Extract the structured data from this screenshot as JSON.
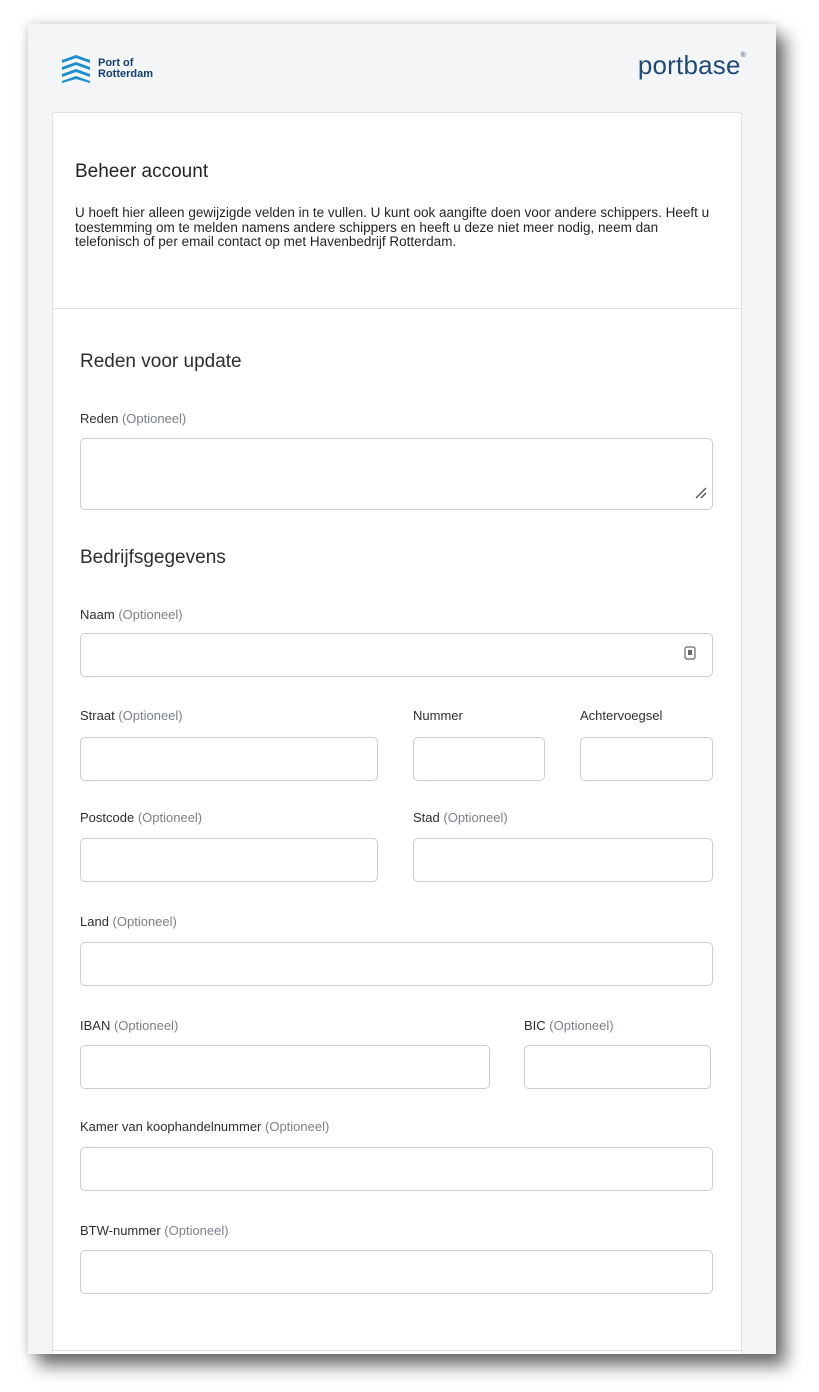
{
  "header": {
    "por_logo_line1": "Port of",
    "por_logo_line2": "Rotterdam",
    "portbase_logo": "portbase",
    "portbase_reg": "®"
  },
  "intro": {
    "title": "Beheer account",
    "text": "U hoeft hier alleen gewijzigde velden in te vullen. U kunt ook aangifte doen voor andere schippers. Heeft u toestemming om te melden namens andere schippers en heeft u deze niet meer nodig, neem dan telefonisch of per email contact op met Havenbedrijf Rotterdam."
  },
  "sections": {
    "reason_title": "Reden voor update",
    "company_title": "Bedrijfsgegevens"
  },
  "optional_suffix": "(Optioneel)",
  "fields": {
    "reden": {
      "label": "Reden",
      "value": ""
    },
    "naam": {
      "label": "Naam",
      "value": ""
    },
    "straat": {
      "label": "Straat",
      "value": ""
    },
    "nummer": {
      "label": "Nummer",
      "value": ""
    },
    "achtervoegsel": {
      "label": "Achtervoegsel",
      "value": ""
    },
    "postcode": {
      "label": "Postcode",
      "value": ""
    },
    "stad": {
      "label": "Stad",
      "value": ""
    },
    "land": {
      "label": "Land",
      "value": ""
    },
    "iban": {
      "label": "IBAN",
      "value": ""
    },
    "bic": {
      "label": "BIC",
      "value": ""
    },
    "kvk": {
      "label": "Kamer van koophandelnummer",
      "value": ""
    },
    "btw": {
      "label": "BTW-nummer",
      "value": ""
    }
  },
  "icons": {
    "resize": "resize-handle-icon",
    "password_manager": "password-manager-icon"
  },
  "colors": {
    "brand_blue": "#1f4a78",
    "por_blue": "#0f3f73",
    "optional_grey": "#7a808a",
    "border": "#c9cdd3"
  }
}
